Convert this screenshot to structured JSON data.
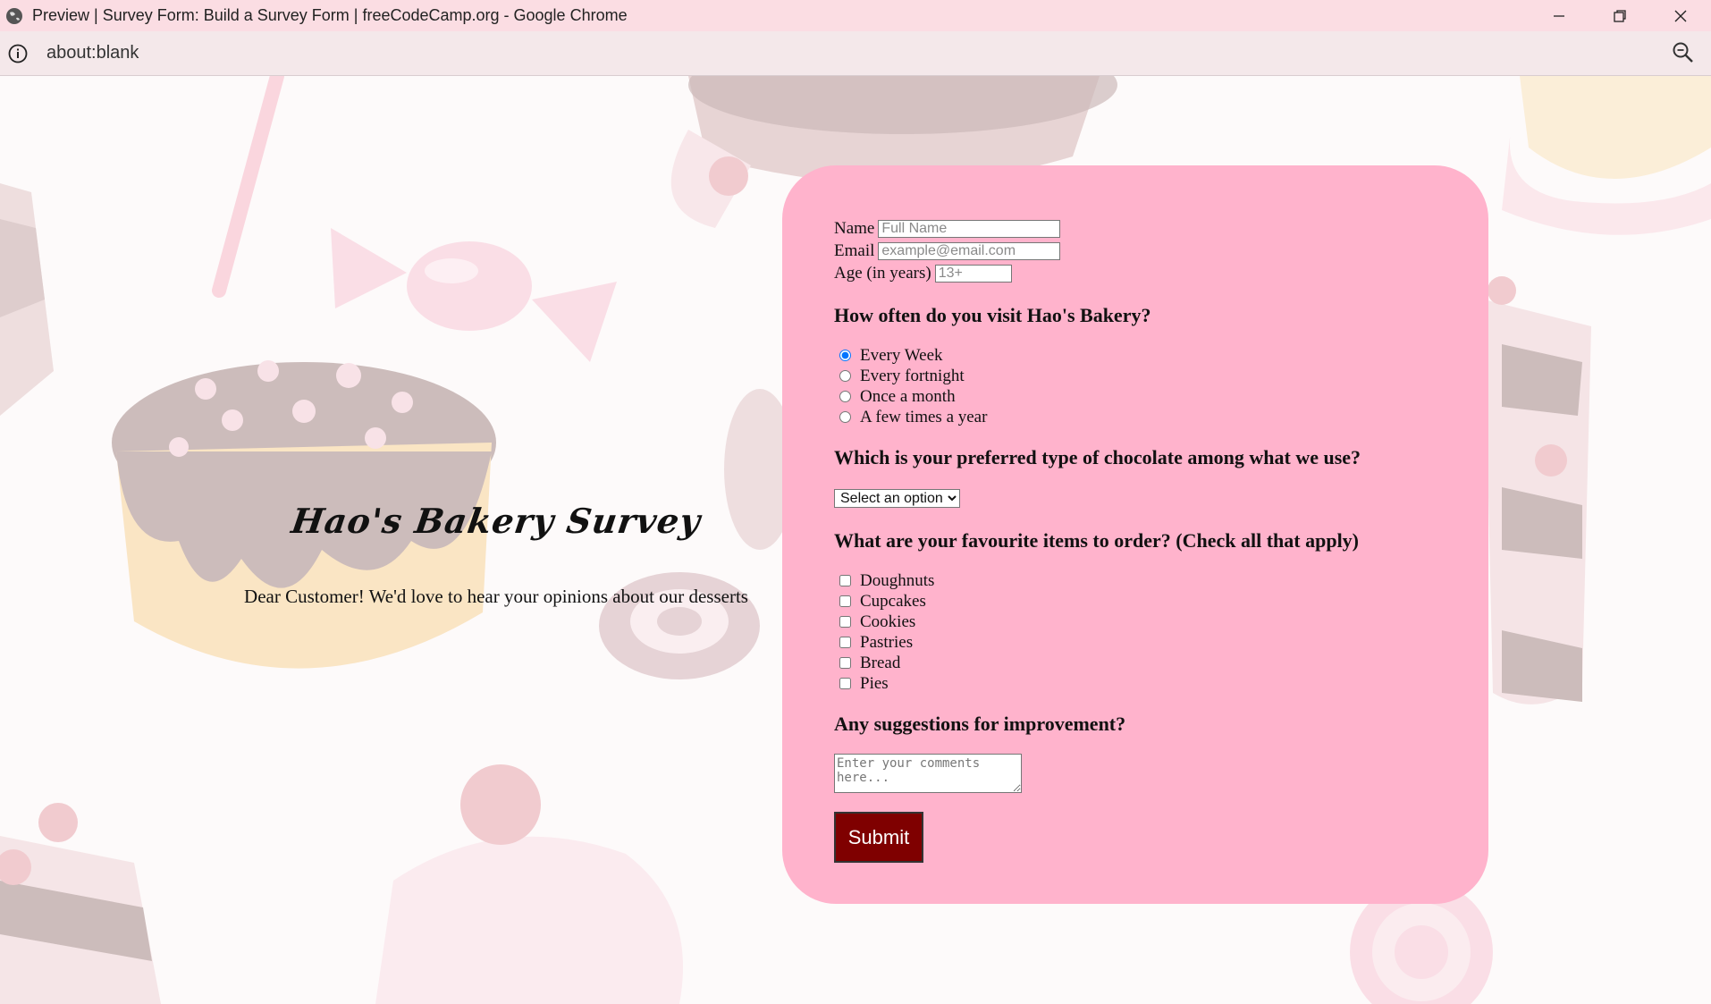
{
  "window": {
    "title": "Preview | Survey Form: Build a Survey Form | freeCodeCamp.org - Google Chrome"
  },
  "address_bar": {
    "url": "about:blank"
  },
  "intro": {
    "title": "Hao's Bakery Survey",
    "description": "Dear Customer! We'd love to hear your opinions about our desserts"
  },
  "form": {
    "name_label": "Name",
    "name_placeholder": "Full Name",
    "email_label": "Email",
    "email_placeholder": "example@email.com",
    "age_label": "Age (in years)",
    "age_placeholder": "13+",
    "visit_question": "How often do you visit Hao's Bakery?",
    "visit_options": [
      "Every Week",
      "Every fortnight",
      "Once a month",
      "A few times a year"
    ],
    "visit_selected": "Every Week",
    "chocolate_question": "Which is your preferred type of chocolate among what we use?",
    "chocolate_select": "Select an option",
    "items_question": "What are your favourite items to order? (Check all that apply)",
    "items_options": [
      "Doughnuts",
      "Cupcakes",
      "Cookies",
      "Pastries",
      "Bread",
      "Pies"
    ],
    "suggestions_question": "Any suggestions for improvement?",
    "comments_placeholder": "Enter your comments here...",
    "submit_label": "Submit"
  },
  "colors": {
    "card_background": "#ffb3cc",
    "submit_background": "#7f0000",
    "titlebar_background": "#fbdde3"
  }
}
